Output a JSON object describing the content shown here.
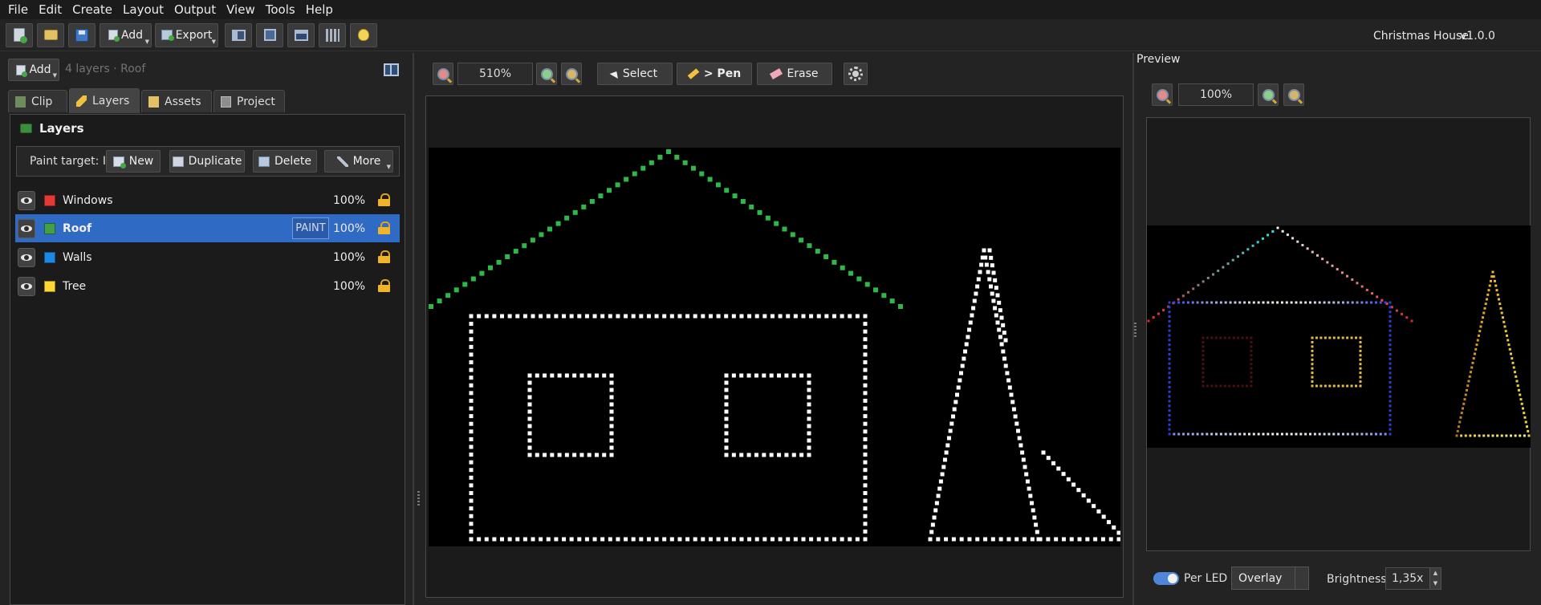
{
  "menubar": {
    "items": [
      "File",
      "Edit",
      "Create",
      "Layout",
      "Output",
      "View",
      "Tools",
      "Help"
    ]
  },
  "toolbar": {
    "add_label": "Add",
    "export_label": "Export",
    "icons": [
      "new-document-icon",
      "open-folder-icon",
      "save-icon",
      "add-icon",
      "export-icon",
      "window-icon",
      "square-icon",
      "panel-icon",
      "library-icon",
      "lightbulb-icon"
    ]
  },
  "app": {
    "project_name": "Christmas House",
    "version": "v1.0.0"
  },
  "left_panel": {
    "add_label": "Add",
    "summary": "4 layers · Roof",
    "tabs": [
      {
        "label": "Clip",
        "active": false
      },
      {
        "label": "Layers",
        "active": true
      },
      {
        "label": "Assets",
        "active": false
      },
      {
        "label": "Project",
        "active": false
      }
    ],
    "layers_title": "Layers",
    "paint_target_label": "Paint target: I",
    "buttons": {
      "new": "New",
      "duplicate": "Duplicate",
      "delete": "Delete",
      "more": "More"
    },
    "layers": [
      {
        "name": "Windows",
        "color": "#e53935",
        "opacity": "100%",
        "selected": false,
        "badge": ""
      },
      {
        "name": "Roof",
        "color": "#43a047",
        "opacity": "100%",
        "selected": true,
        "badge": "PAINT"
      },
      {
        "name": "Walls",
        "color": "#1e88e5",
        "opacity": "100%",
        "selected": false,
        "badge": ""
      },
      {
        "name": "Tree",
        "color": "#fdd835",
        "opacity": "100%",
        "selected": false,
        "badge": ""
      }
    ]
  },
  "editor": {
    "zoom": "510%",
    "select_label": "Select",
    "pen_label": "> Pen",
    "erase_label": "Erase"
  },
  "preview": {
    "label": "Preview",
    "zoom": "100%",
    "per_led_label": "Per LED",
    "per_led_on": true,
    "blend_mode": "Overlay",
    "brightness_label": "Brightness",
    "brightness_value": "1,35x"
  },
  "colors": {
    "roof_led": "#2eb84a",
    "wall_led": "#ffffff",
    "selection": "#2f6ac4"
  }
}
